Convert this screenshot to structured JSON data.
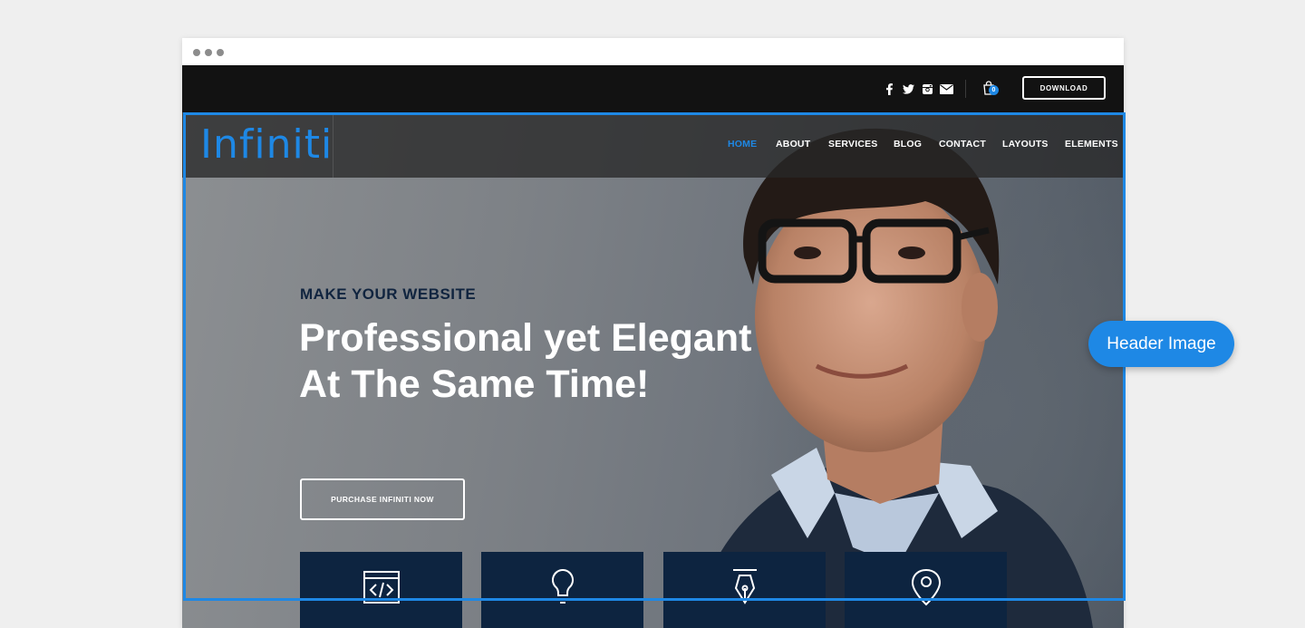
{
  "colors": {
    "accent": "#1e88e5",
    "topbar": "#121212",
    "card": "#0d2440",
    "eyebrow": "#10243f"
  },
  "browser": {
    "window_dots": [
      "dot",
      "dot",
      "dot"
    ]
  },
  "topbar": {
    "social_icons": [
      "facebook-icon",
      "twitter-icon",
      "instagram-icon",
      "mail-icon"
    ],
    "cart_count": "0",
    "download_label": "DOWNLOAD"
  },
  "header": {
    "logo": "Infiniti",
    "nav": [
      {
        "label": "HOME",
        "active": true
      },
      {
        "label": "ABOUT",
        "active": false
      },
      {
        "label": "SERVICES",
        "active": false
      },
      {
        "label": "BLOG",
        "active": false
      },
      {
        "label": "CONTACT",
        "active": false
      },
      {
        "label": "LAYOUTS",
        "active": false
      },
      {
        "label": "ELEMENTS",
        "active": false
      }
    ]
  },
  "hero": {
    "eyebrow": "MAKE YOUR WEBSITE",
    "headline_line1": "Professional yet Elegant",
    "headline_line2": "At The Same Time!",
    "cta_label": "PURCHASE INFINITI NOW"
  },
  "features": {
    "icons": [
      "code-icon",
      "lightbulb-icon",
      "pen-nib-icon",
      "location-pin-icon"
    ]
  },
  "annotation": {
    "callout_label": "Header Image"
  }
}
